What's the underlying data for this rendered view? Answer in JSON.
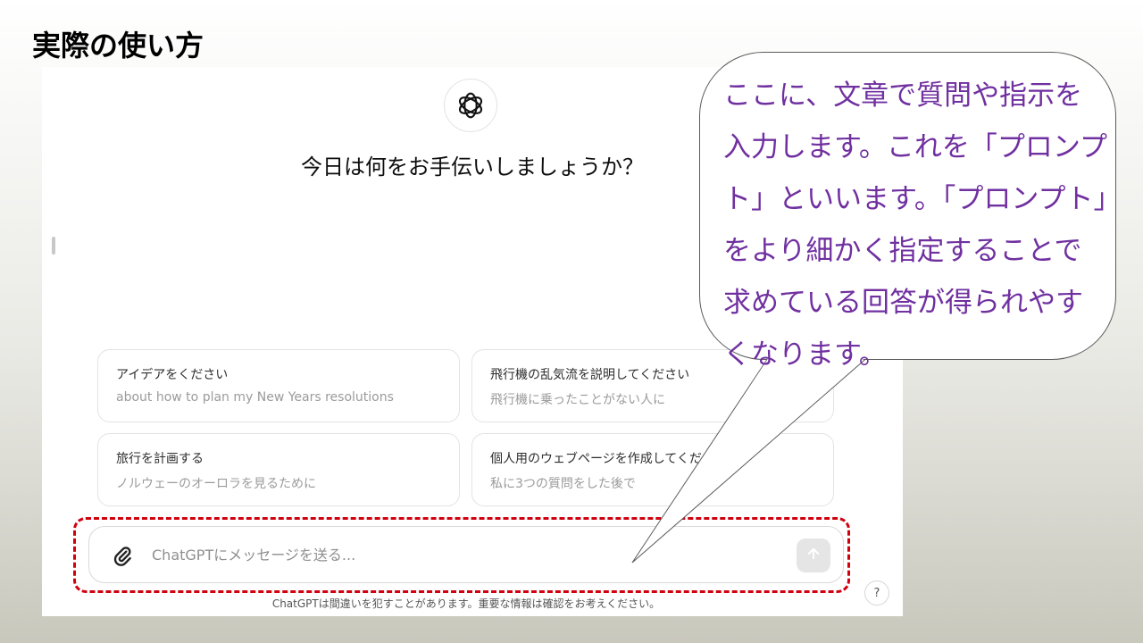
{
  "slide": {
    "title": "実際の使い方"
  },
  "chat": {
    "heading": "今日は何をお手伝いしましょうか？",
    "cards": [
      {
        "title": "アイデアをください",
        "subtitle": "about how to plan my New Years resolutions"
      },
      {
        "title": "飛行機の乱気流を説明してください",
        "subtitle": "飛行機に乗ったことがない人に"
      },
      {
        "title": "旅行を計画する",
        "subtitle": "ノルウェーのオーロラを見るために"
      },
      {
        "title": "個人用のウェブページを作成してください",
        "subtitle": "私に3つの質問をした後で"
      }
    ],
    "input": {
      "placeholder": "ChatGPTにメッセージを送る..."
    },
    "disclaimer": "ChatGPTは間違いを犯すことがあります。重要な情報は確認をお考えください。",
    "help_label": "?"
  },
  "callout": {
    "text": "ここに、文章で質問や指示を入力します。これを「プロンプト」といいます。「プロンプト」をより細かく指定することで求めている回答が得られやすくなります。"
  },
  "colors": {
    "callout_text": "#7030a0",
    "highlight_border": "#d0000f",
    "send_button_bg": "#e5e5e5"
  },
  "icons": {
    "logo": "openai-logo-icon",
    "attach": "paperclip-icon",
    "send": "arrow-up-icon",
    "help": "question-icon"
  }
}
